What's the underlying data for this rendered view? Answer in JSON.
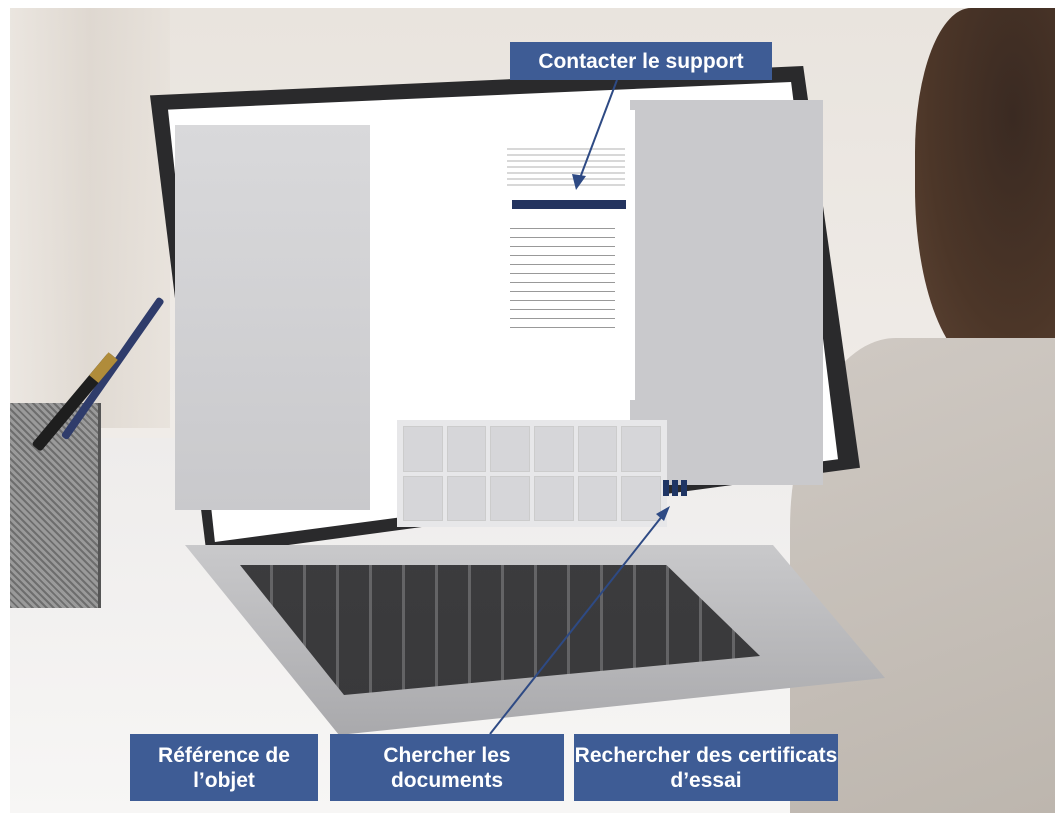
{
  "callouts": {
    "contact": "Contacter le support",
    "reference": "Référence de l’objet",
    "documents": "Chercher les documents",
    "certificates": "Rechercher des certificats d’essai"
  },
  "colors": {
    "callout_bg": "#3e5c95",
    "arrow": "#2e4a84",
    "screen_button": "#1f3564"
  }
}
